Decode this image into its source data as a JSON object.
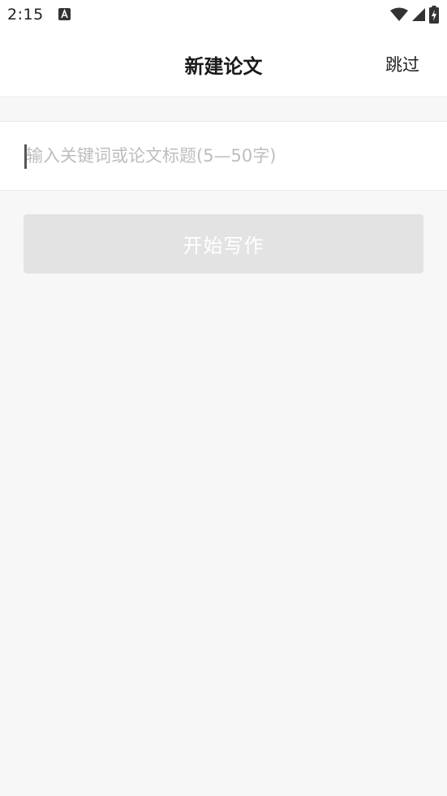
{
  "status_bar": {
    "time": "2:15",
    "notification_icon": "font-a-icon",
    "wifi_icon": "wifi-icon",
    "signal_icon": "cell-signal-icon",
    "battery_icon": "battery-charging-icon"
  },
  "header": {
    "title": "新建论文",
    "skip_label": "跳过"
  },
  "form": {
    "keyword_placeholder": "输入关键词或论文标题(5—50字)",
    "keyword_value": "",
    "start_label": "开始写作"
  },
  "colors": {
    "background": "#f7f7f7",
    "surface": "#ffffff",
    "disabled_button": "#e3e3e3",
    "placeholder_text": "#bdbdbd"
  }
}
